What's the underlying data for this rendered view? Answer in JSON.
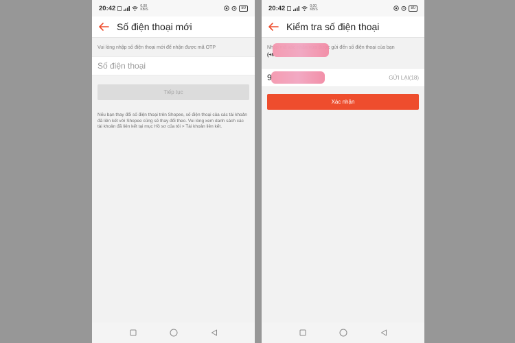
{
  "status_bar": {
    "time": "20:42",
    "net_top": "0,00",
    "net_bottom": "KB/S",
    "battery": "80"
  },
  "left_screen": {
    "title": "Số điện thoại mới",
    "hint": "Vui lòng nhập số điện thoại mới để nhận được mã OTP",
    "phone_placeholder": "Số điện thoại",
    "continue_label": "Tiếp tục",
    "note": "Nếu bạn thay đổi số điện thoại trên Shopee, số điện thoại của các tài khoản đã liên kết với Shopee cũng sẽ thay đổi theo. Vui lòng xem danh sách các tài khoản đã liên kết tại mục Hồ sơ của tôi > Tài khoản liên kết."
  },
  "right_screen": {
    "title": "Kiểm tra số điện thoại",
    "hint": "Nhập mã xác nhận vừa được gửi đến số điện thoại của bạn",
    "number_prefix": "(+8",
    "otp_prefix": "9",
    "resend_label": "GỬI LẠI(18)",
    "confirm_label": "Xác nhận"
  },
  "icons": {
    "back": "arrow-left-icon",
    "nav_recents": "square-icon",
    "nav_home": "circle-icon",
    "nav_back": "triangle-back-icon"
  },
  "colors": {
    "accent": "#ee4d2d",
    "backdrop": "#979797",
    "screen_bg": "#f2f2f2"
  }
}
